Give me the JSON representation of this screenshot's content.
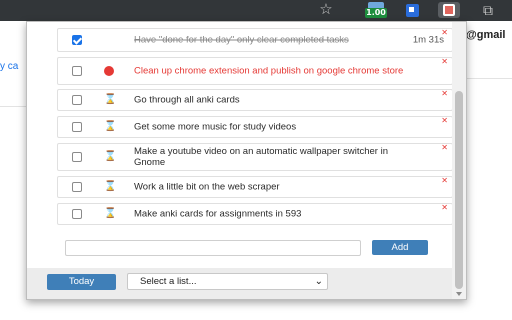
{
  "browser": {
    "extension_badge": "1.00"
  },
  "page": {
    "left_text": "y ca",
    "right_text": "@gmail"
  },
  "tasks": [
    {
      "text": "Have \"done for the day\" only clear completed tasks",
      "state": "done",
      "status_icon": "none",
      "time": "1m 31s"
    },
    {
      "text": "Clean up chrome extension and publish on google chrome store",
      "state": "urgent",
      "status_icon": "red-dot-icon",
      "time": ""
    },
    {
      "text": "Go through all anki cards",
      "state": "open",
      "status_icon": "hourglass-icon",
      "time": ""
    },
    {
      "text": "Get some more music for study videos",
      "state": "open",
      "status_icon": "hourglass-icon",
      "time": ""
    },
    {
      "text": "Make a youtube video on an automatic wallpaper switcher in Gnome",
      "state": "open",
      "status_icon": "hourglass-icon",
      "time": ""
    },
    {
      "text": "Work a little bit on the web scraper",
      "state": "open",
      "status_icon": "hourglass-icon",
      "time": ""
    },
    {
      "text": "Make anki cards for assignments in 593",
      "state": "open",
      "status_icon": "hourglass-icon",
      "time": ""
    }
  ],
  "add": {
    "placeholder": "",
    "button_label": "Add"
  },
  "footer": {
    "today_label": "Today",
    "list_select_value": "Select a list..."
  },
  "colors": {
    "accent": "#3f7fb8",
    "urgent": "#e53935",
    "checkbox_checked": "#1a73e8"
  }
}
